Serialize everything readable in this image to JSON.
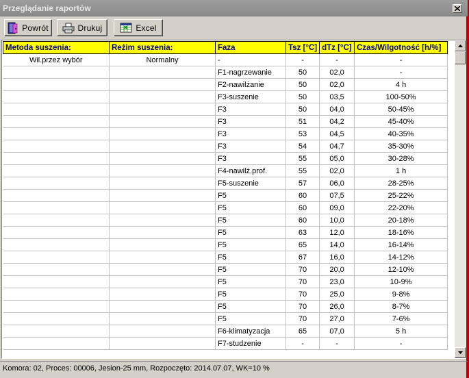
{
  "window": {
    "title": "Przeglądanie raportów"
  },
  "toolbar": {
    "back_label": "Powrót",
    "print_label": "Drukuj",
    "excel_label": "Excel"
  },
  "table": {
    "headers": [
      "Metoda suszenia:",
      "Reżim suszenia:",
      "Faza",
      "Tsz [°C]",
      "dTz [°C]",
      "Czas/Wilgotność [h/%]"
    ],
    "rows": [
      [
        "Wil.przez wybór",
        "Normalny",
        "-",
        "-",
        "-",
        "-"
      ],
      [
        "",
        "",
        "F1-nagrzewanie",
        "50",
        "02,0",
        "-"
      ],
      [
        "",
        "",
        "F2-nawilżanie",
        "50",
        "02,0",
        "4 h"
      ],
      [
        "",
        "",
        "F3-suszenie",
        "50",
        "03,5",
        "100-50%"
      ],
      [
        "",
        "",
        "F3",
        "50",
        "04,0",
        "50-45%"
      ],
      [
        "",
        "",
        "F3",
        "51",
        "04,2",
        "45-40%"
      ],
      [
        "",
        "",
        "F3",
        "53",
        "04,5",
        "40-35%"
      ],
      [
        "",
        "",
        "F3",
        "54",
        "04,7",
        "35-30%"
      ],
      [
        "",
        "",
        "F3",
        "55",
        "05,0",
        "30-28%"
      ],
      [
        "",
        "",
        "F4-nawilż.prof.",
        "55",
        "02,0",
        "1 h"
      ],
      [
        "",
        "",
        "F5-suszenie",
        "57",
        "06,0",
        "28-25%"
      ],
      [
        "",
        "",
        "F5",
        "60",
        "07,5",
        "25-22%"
      ],
      [
        "",
        "",
        "F5",
        "60",
        "09,0",
        "22-20%"
      ],
      [
        "",
        "",
        "F5",
        "60",
        "10,0",
        "20-18%"
      ],
      [
        "",
        "",
        "F5",
        "63",
        "12,0",
        "18-16%"
      ],
      [
        "",
        "",
        "F5",
        "65",
        "14,0",
        "16-14%"
      ],
      [
        "",
        "",
        "F5",
        "67",
        "16,0",
        "14-12%"
      ],
      [
        "",
        "",
        "F5",
        "70",
        "20,0",
        "12-10%"
      ],
      [
        "",
        "",
        "F5",
        "70",
        "23,0",
        "10-9%"
      ],
      [
        "",
        "",
        "F5",
        "70",
        "25,0",
        "9-8%"
      ],
      [
        "",
        "",
        "F5",
        "70",
        "26,0",
        "8-7%"
      ],
      [
        "",
        "",
        "F5",
        "70",
        "27,0",
        "7-6%"
      ],
      [
        "",
        "",
        "F6-klimatyzacja",
        "65",
        "07,0",
        "5 h"
      ],
      [
        "",
        "",
        "F7-studzenie",
        "-",
        "-",
        "-"
      ]
    ]
  },
  "status": {
    "text": "Komora: 02,  Proces: 00006,  Jesion-25 mm,  Rozpoczęto: 2014.07.07,  WK=10 %"
  },
  "icons": {
    "back": "door-exit-icon",
    "print": "printer-icon",
    "excel": "spreadsheet-icon",
    "close": "close-icon"
  },
  "colors": {
    "header_bg": "#ffff00",
    "header_text": "#00008b",
    "frame": "#c00000"
  }
}
